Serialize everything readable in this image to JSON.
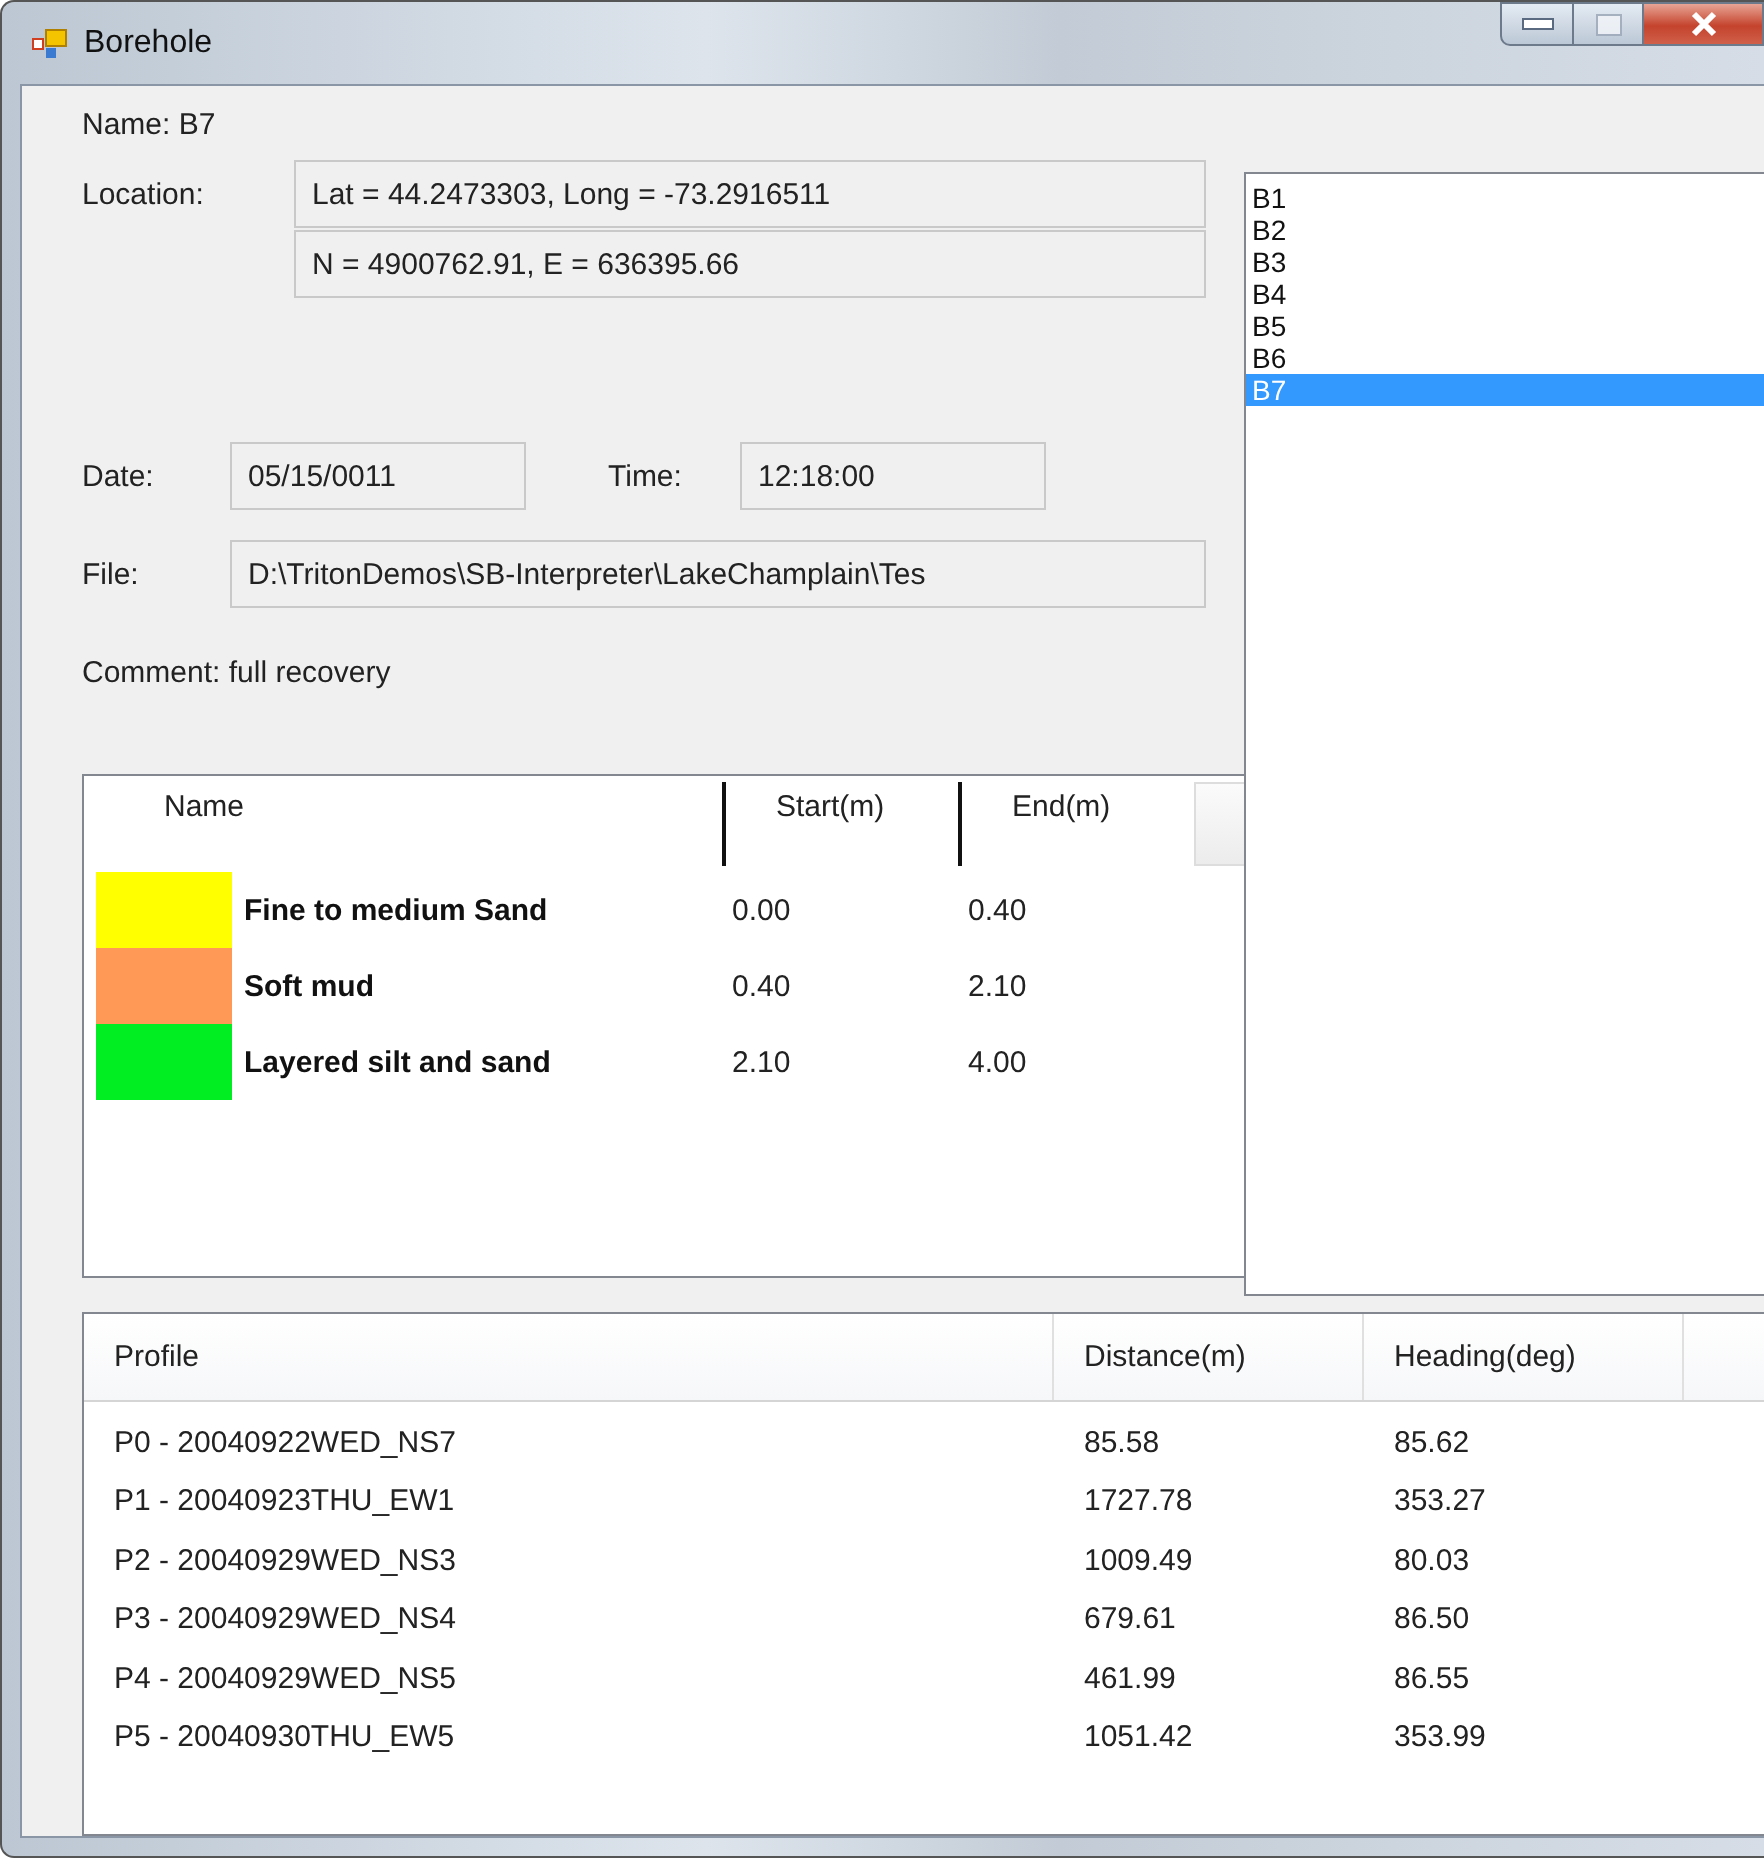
{
  "window": {
    "title": "Borehole"
  },
  "details": {
    "name": "Name: B7",
    "location_label": "Location:",
    "location_values": [
      "Lat = 44.2473303, Long = -73.2916511",
      "N = 4900762.91, E = 636395.66"
    ],
    "date_label": "Date:",
    "date_value": "05/15/0011",
    "time_label": "Time:",
    "time_value": "12:18:00",
    "file_label": "File:",
    "file_value": "D:\\TritonDemos\\SB-Interpreter\\LakeChamplain\\Tes",
    "comment": "Comment: full recovery"
  },
  "layers": {
    "columns": [
      "Name",
      "Start(m)",
      "End(m)"
    ],
    "rows": [
      {
        "name": "Fine to medium Sand",
        "start": "0.00",
        "end": "0.40",
        "color": "#ffff00"
      },
      {
        "name": "Soft mud",
        "start": "0.40",
        "end": "2.10",
        "color": "#ff9955"
      },
      {
        "name": "Layered silt and sand",
        "start": "2.10",
        "end": "4.00",
        "color": "#00ee22"
      }
    ]
  },
  "boreholes": {
    "items": [
      {
        "label": "B1",
        "selected": false
      },
      {
        "label": "B2",
        "selected": false
      },
      {
        "label": "B3",
        "selected": false
      },
      {
        "label": "B4",
        "selected": false
      },
      {
        "label": "B5",
        "selected": false
      },
      {
        "label": "B6",
        "selected": false
      },
      {
        "label": "B7",
        "selected": true
      }
    ]
  },
  "profiles": {
    "columns": [
      "Profile",
      "Distance(m)",
      "Heading(deg)"
    ],
    "rows": [
      [
        "P0 - 20040922WED_NS7",
        "85.58",
        "85.62"
      ],
      [
        "P1 - 20040923THU_EW1",
        "1727.78",
        "353.27"
      ],
      [
        "P2 - 20040929WED_NS3",
        "1009.49",
        "80.03"
      ],
      [
        "P3 - 20040929WED_NS4",
        "679.61",
        "86.50"
      ],
      [
        "P4 - 20040929WED_NS5",
        "461.99",
        "86.55"
      ],
      [
        "P5 - 20040930THU_EW5",
        "1051.42",
        "353.99"
      ]
    ]
  }
}
